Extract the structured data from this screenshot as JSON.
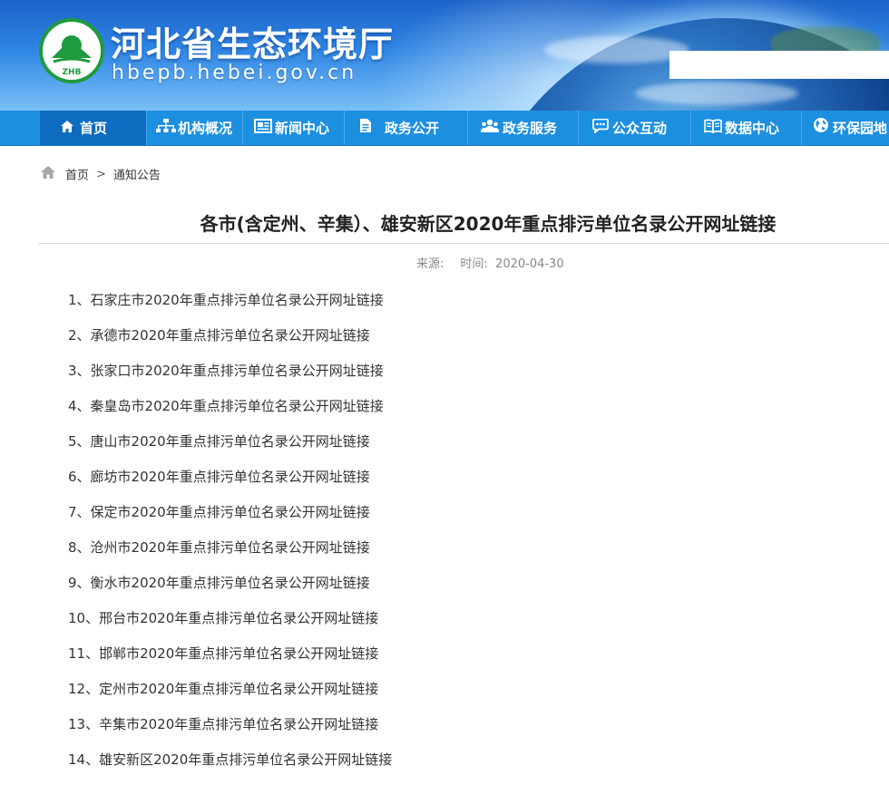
{
  "header": {
    "site_title": "河北省生态环境厅",
    "site_url": "hbepb.hebei.gov.cn",
    "logo_text": "ZHB",
    "search_placeholder": ""
  },
  "nav": {
    "items": [
      {
        "label": "首页",
        "icon": "home-icon"
      },
      {
        "label": "机构概况",
        "icon": "org-chart-icon"
      },
      {
        "label": "新闻中心",
        "icon": "news-icon"
      },
      {
        "label": "政务公开",
        "icon": "document-icon"
      },
      {
        "label": "政务服务",
        "icon": "people-icon"
      },
      {
        "label": "公众互动",
        "icon": "chat-icon"
      },
      {
        "label": "数据中心",
        "icon": "book-icon"
      },
      {
        "label": "环保园地",
        "icon": "globe-icon"
      }
    ],
    "active": "首页"
  },
  "breadcrumb": {
    "home": "首页",
    "separator": ">",
    "current": "通知公告"
  },
  "article": {
    "title": "各市(含定州、辛集）、雄安新区2020年重点排污单位名录公开网址链接",
    "source_label": "来源:",
    "time_label": "时间:",
    "time_value": "2020-04-30",
    "links": [
      "1、石家庄市2020年重点排污单位名录公开网址链接",
      "2、承德市2020年重点排污单位名录公开网址链接",
      "3、张家口市2020年重点排污单位名录公开网址链接",
      "4、秦皇岛市2020年重点排污单位名录公开网址链接",
      "5、唐山市2020年重点排污单位名录公开网址链接",
      "6、廊坊市2020年重点排污单位名录公开网址链接",
      "7、保定市2020年重点排污单位名录公开网址链接",
      "8、沧州市2020年重点排污单位名录公开网址链接",
      "9、衡水市2020年重点排污单位名录公开网址链接",
      "10、邢台市2020年重点排污单位名录公开网址链接",
      "11、邯郸市2020年重点排污单位名录公开网址链接",
      "12、定州市2020年重点排污单位名录公开网址链接",
      "13、辛集市2020年重点排污单位名录公开网址链接",
      "14、雄安新区2020年重点排污单位名录公开网址链接"
    ]
  },
  "colors": {
    "nav_bg": "#1d8fe0",
    "nav_active": "#0d6cc0",
    "logo_green": "#1f9a3e"
  }
}
